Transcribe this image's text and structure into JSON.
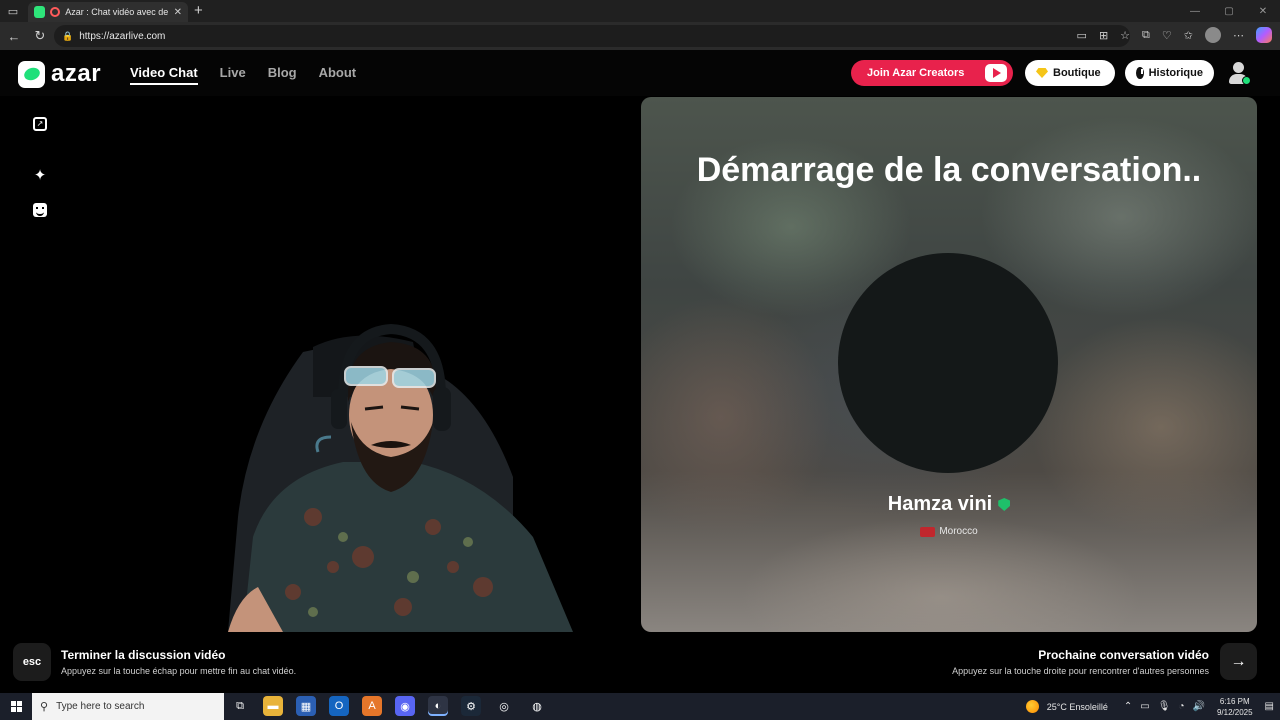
{
  "browser": {
    "tab_title": "Azar : Chat vidéo avec de nouveaux amis",
    "url": "https://azarlive.com"
  },
  "site": {
    "logo_text": "azar",
    "nav": [
      {
        "label": "Video Chat",
        "active": true
      },
      {
        "label": "Live"
      },
      {
        "label": "Blog"
      },
      {
        "label": "About"
      }
    ],
    "creators_label": "Join Azar Creators",
    "boutique_label": "Boutique",
    "historique_label": "Historique"
  },
  "peer": {
    "status_title": "Démarrage de la conversation..",
    "name": "Hamza vini",
    "country": "Morocco"
  },
  "hints": {
    "esc_key": "esc",
    "end_title": "Terminer la discussion vidéo",
    "end_sub": "Appuyez sur la touche échap pour mettre fin au chat vidéo.",
    "next_title": "Prochaine conversation vidéo",
    "next_sub": "Appuyez sur la touche droite pour rencontrer d'autres personnes",
    "next_icon": "arrow-right-icon"
  },
  "taskbar": {
    "search_placeholder": "Type here to search",
    "weather": "25°C  Ensoleillé",
    "time": "6:16 PM",
    "date": "9/12/2025"
  },
  "colors": {
    "brand_green": "#1fe07a",
    "creators_red": "#e8224c",
    "verified_green": "#1fc06a"
  }
}
